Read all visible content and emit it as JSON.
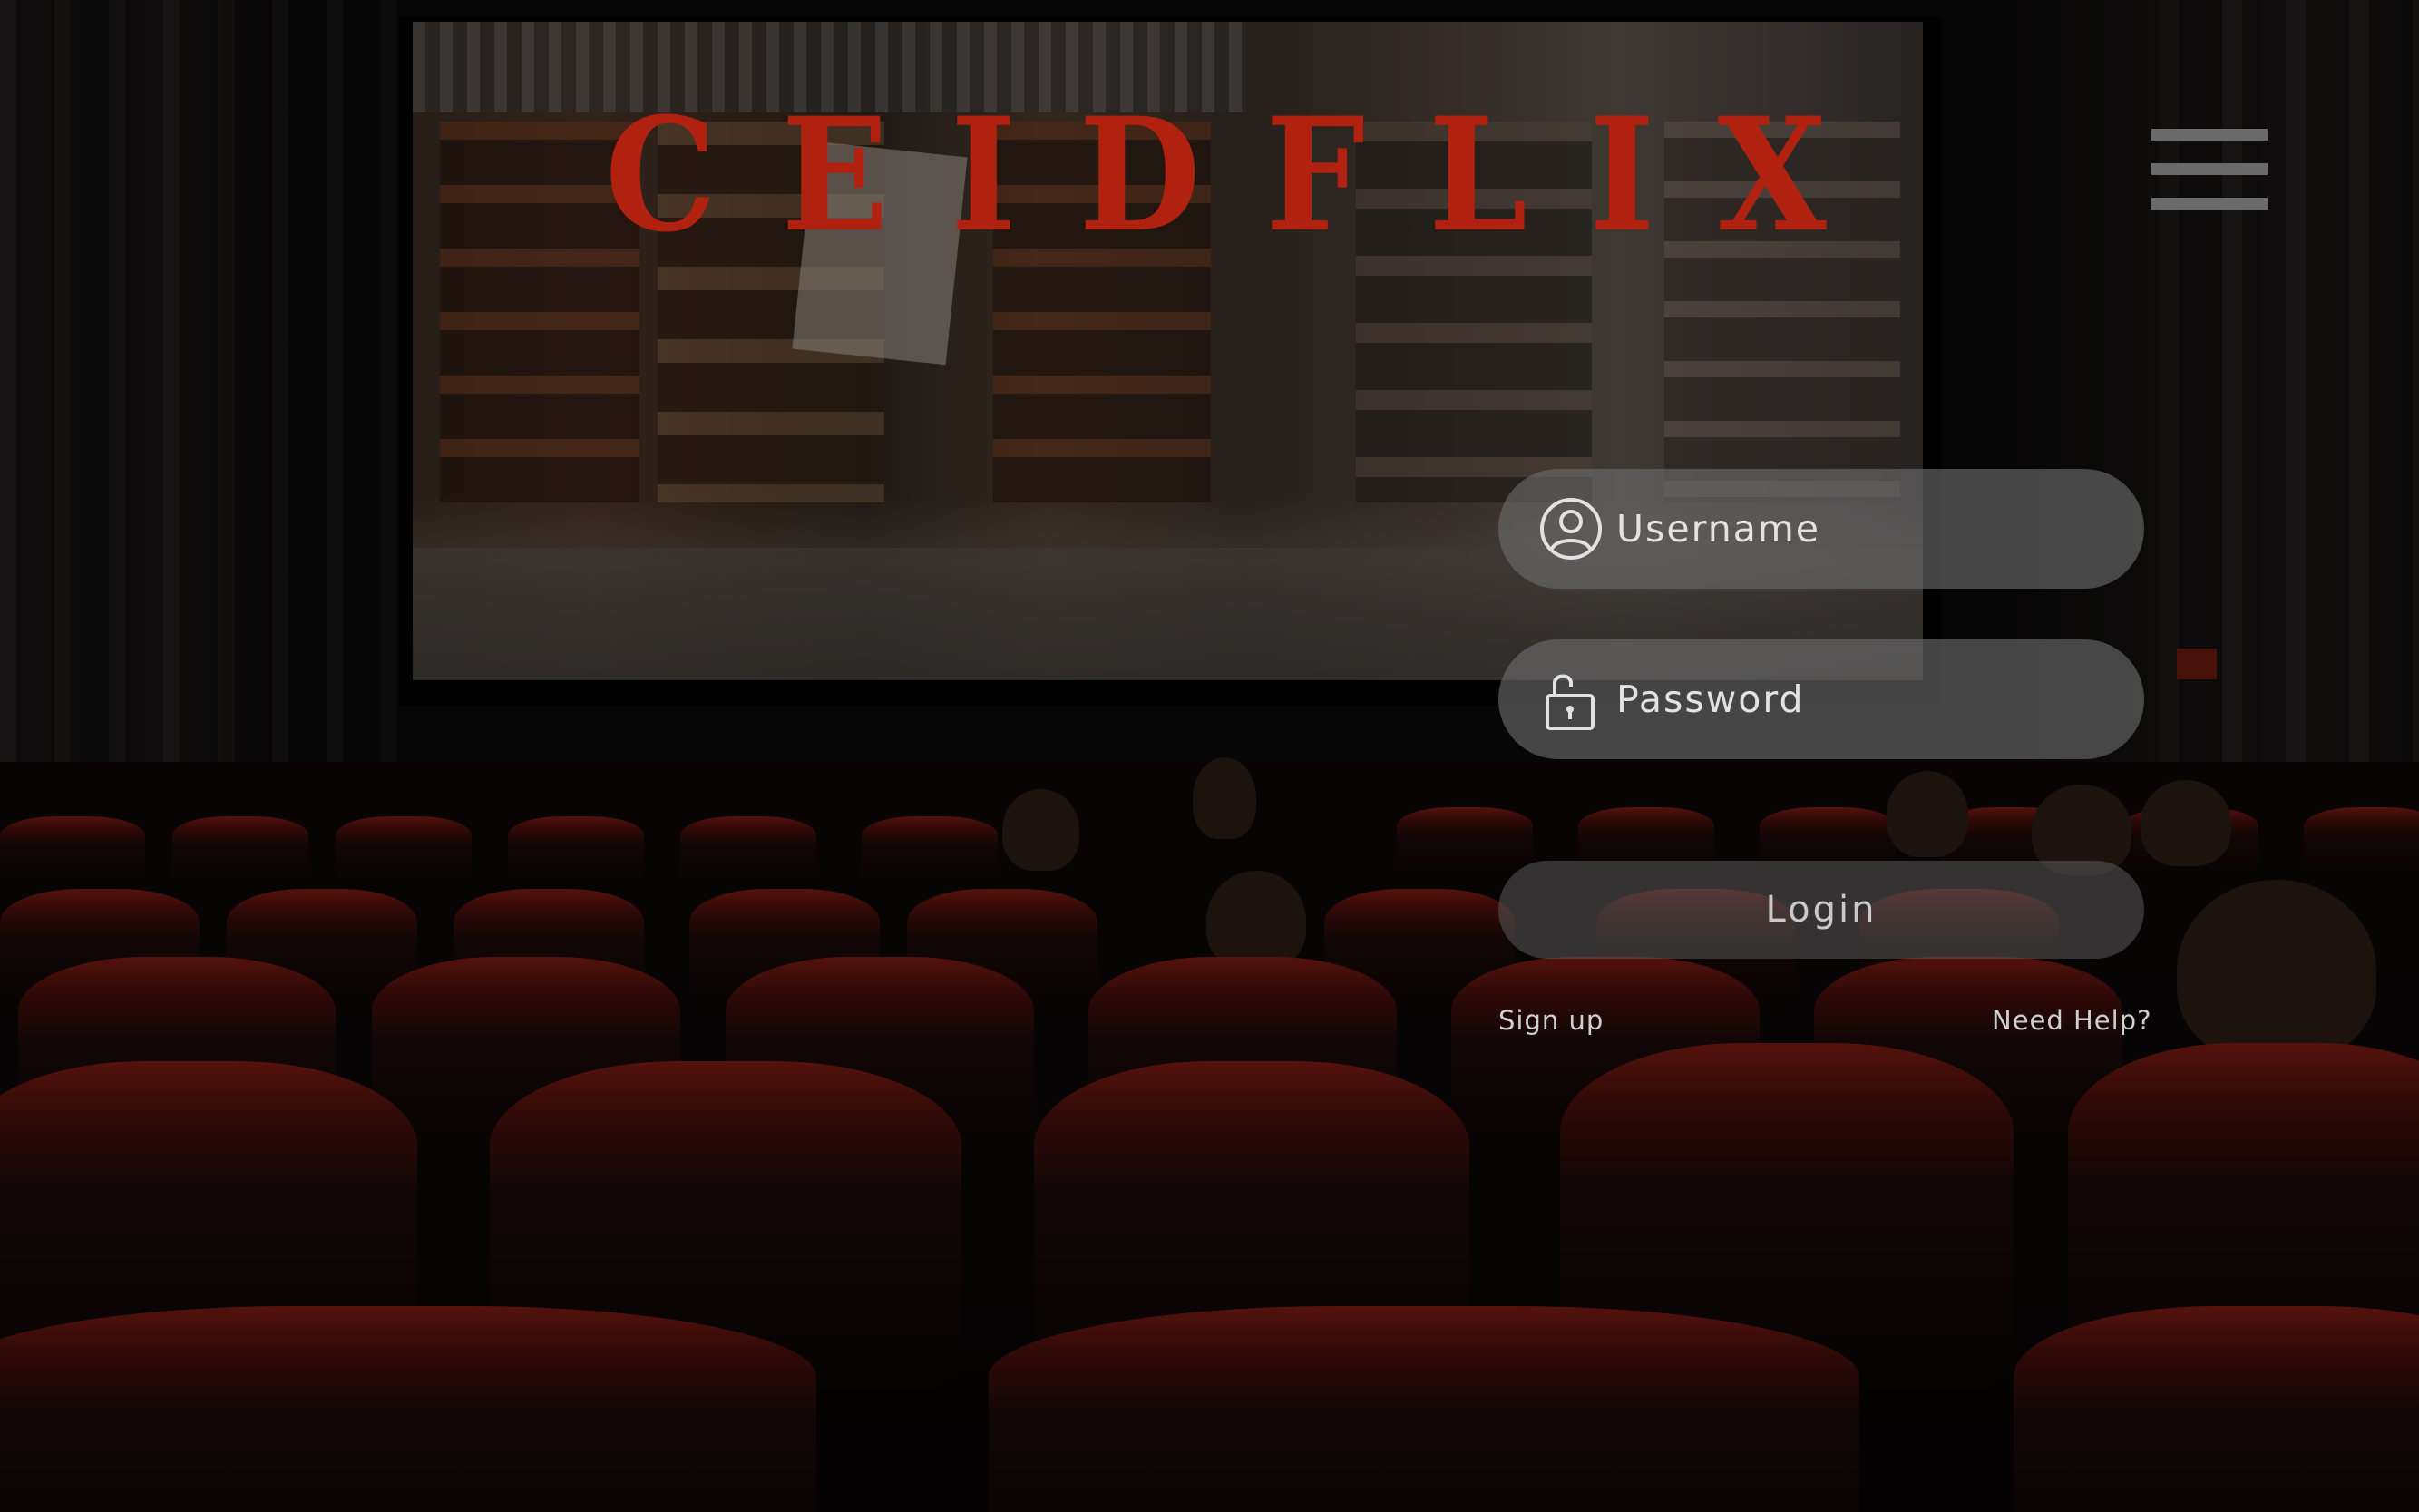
{
  "app": {
    "logo_text": "CEIDFLIX"
  },
  "header": {
    "menu_icon": "hamburger-menu-icon"
  },
  "login_form": {
    "username": {
      "placeholder": "Username",
      "value": "",
      "icon": "user-icon"
    },
    "password": {
      "placeholder": "Password",
      "value": "",
      "icon": "unlocked-padlock-icon"
    },
    "login_label": "Login",
    "signup_label": "Sign up",
    "help_label": "Need Help?"
  },
  "colors": {
    "brand_red": "#b0220f",
    "field_bg": "#6e6e6e",
    "text_light": "#e2e2e2"
  }
}
